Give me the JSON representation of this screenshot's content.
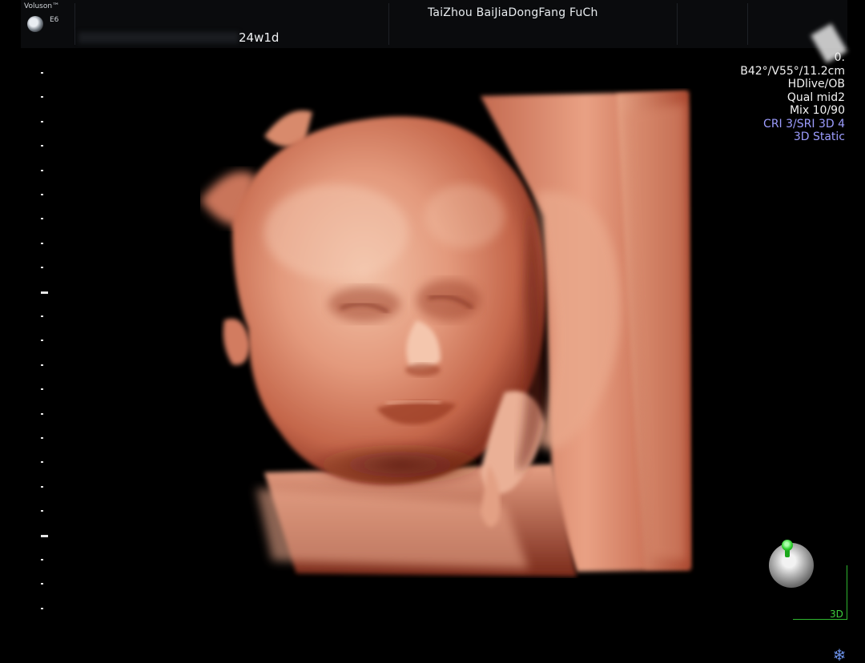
{
  "header": {
    "brand": "Voluson™",
    "model": "E6",
    "hospital": "TaiZhou BaiJiaDongFang FuCh",
    "gestational_age": "24w1d"
  },
  "info_panel": {
    "line1": "0.",
    "probe": "B42°/V55°/11.2cm",
    "mode": "HDlive/OB",
    "quality": "Qual mid2",
    "mix": "Mix 10/90",
    "cri": "CRI 3/SRI 3D 4",
    "static": "3D Static"
  },
  "viewer": {
    "axis_label": "3D",
    "freeze_icon": "snowflake-icon",
    "orientation_icon": "orientation-ball-icon"
  },
  "colors": {
    "background": "#000000",
    "info_blue": "#9d9dff",
    "orientation_green": "#2ccf2c",
    "render_tissue": "#c9725a"
  }
}
